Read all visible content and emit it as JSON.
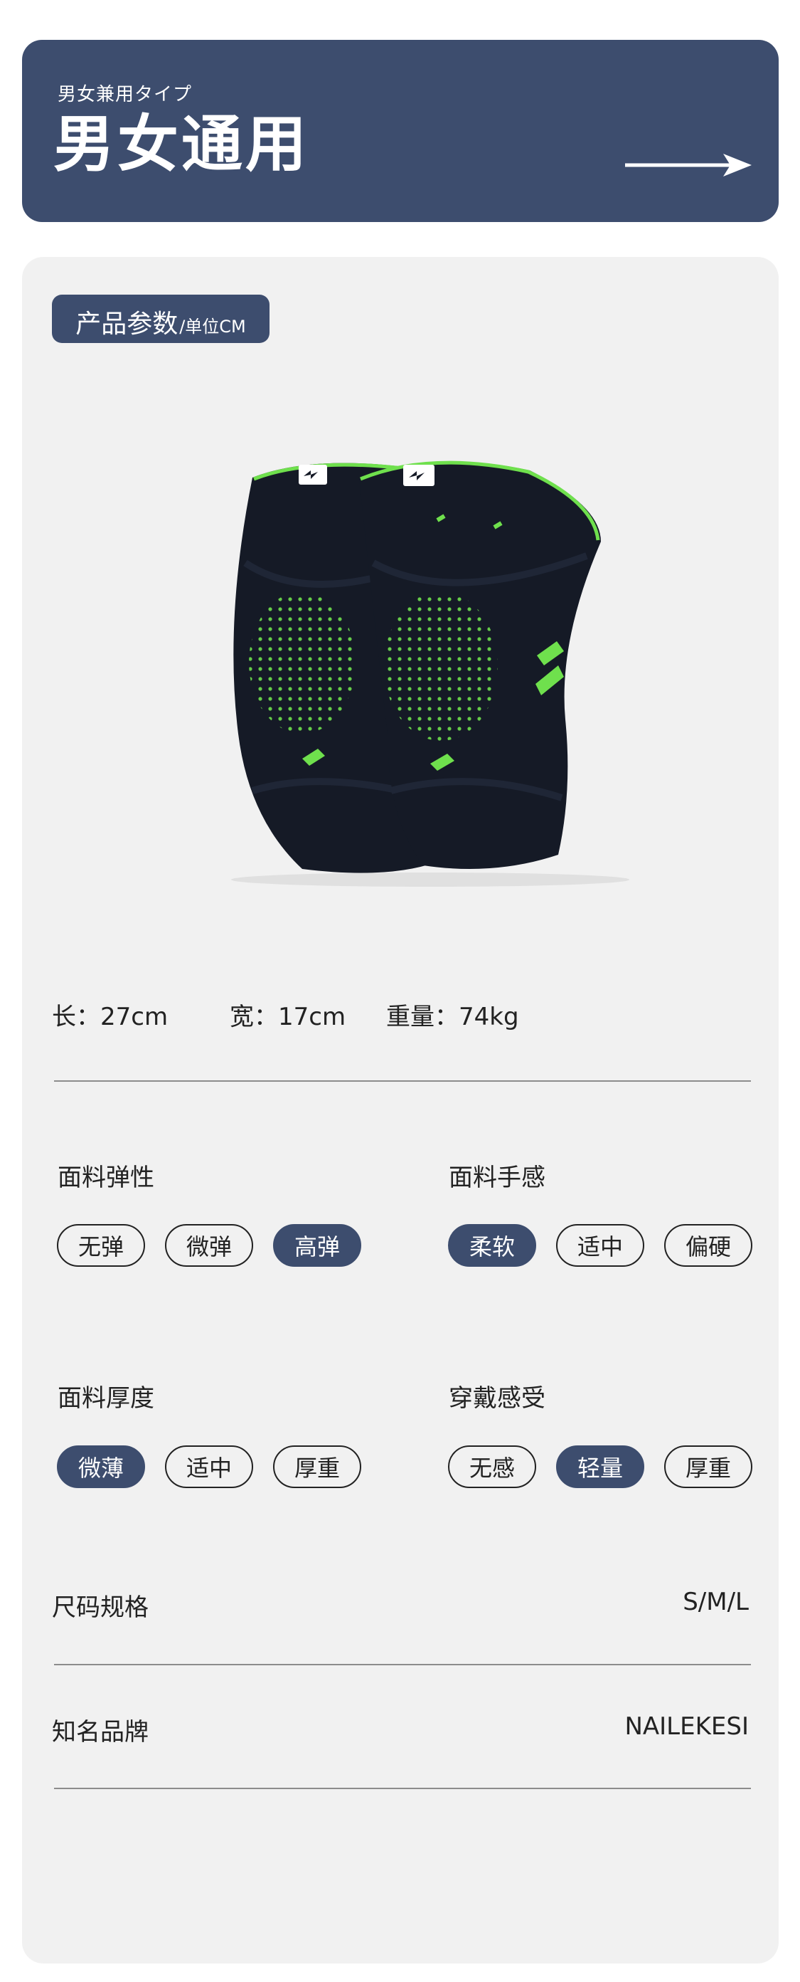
{
  "banner": {
    "subtitle": "男女兼用タイプ",
    "title": "男女通用"
  },
  "params": {
    "label_main": "产品参数",
    "label_sub": "/单位CM"
  },
  "product": {
    "logo_text": "NAILEKESI",
    "colors": {
      "fabric": "#151a26",
      "accent": "#6fe04d"
    }
  },
  "dimensions": {
    "length": "长：27cm",
    "width": "宽：17cm",
    "weight": "重量：74kg"
  },
  "attributes": [
    {
      "title": "面料弹性",
      "options": [
        "无弹",
        "微弹",
        "高弹"
      ],
      "selected": "高弹"
    },
    {
      "title": "面料手感",
      "options": [
        "柔软",
        "适中",
        "偏硬"
      ],
      "selected": "柔软"
    },
    {
      "title": "面料厚度",
      "options": [
        "微薄",
        "适中",
        "厚重"
      ],
      "selected": "微薄"
    },
    {
      "title": "穿戴感受",
      "options": [
        "无感",
        "轻量",
        "厚重"
      ],
      "selected": "轻量"
    }
  ],
  "specs": [
    {
      "label": "尺码规格",
      "value": "S/M/L"
    },
    {
      "label": "知名品牌",
      "value": "NAILEKESI"
    }
  ],
  "colors": {
    "navy": "#3d4d6e",
    "card_bg": "#f1f1f1"
  }
}
